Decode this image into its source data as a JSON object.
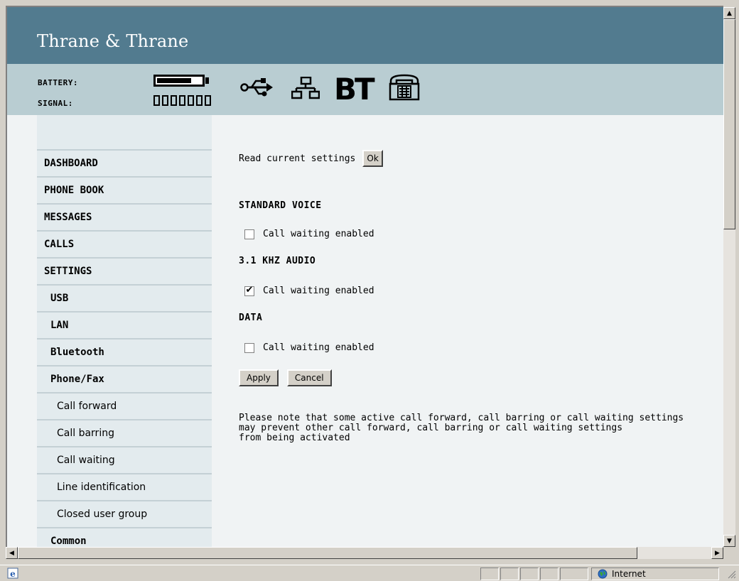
{
  "brand": {
    "name": "Thrane & Thrane"
  },
  "status": {
    "battery_label": "BATTERY:",
    "signal_label": "SIGNAL:",
    "battery_level": 0.72,
    "signal_bars_total": 7,
    "signal_bars_on": 0,
    "bt_label": "BT",
    "interface_icons": [
      "usb-icon",
      "lan-icon",
      "bluetooth-icon",
      "phone-icon"
    ]
  },
  "nav": {
    "items": [
      {
        "label": "DASHBOARD",
        "level": 0
      },
      {
        "label": "PHONE BOOK",
        "level": 0
      },
      {
        "label": "MESSAGES",
        "level": 0
      },
      {
        "label": "CALLS",
        "level": 0
      },
      {
        "label": "SETTINGS",
        "level": 0
      },
      {
        "label": "USB",
        "level": 1
      },
      {
        "label": "LAN",
        "level": 1
      },
      {
        "label": "Bluetooth",
        "level": 1
      },
      {
        "label": "Phone/Fax",
        "level": 1
      },
      {
        "label": "Call forward",
        "level": 2
      },
      {
        "label": "Call barring",
        "level": 2
      },
      {
        "label": "Call waiting",
        "level": 2
      },
      {
        "label": "Line identification",
        "level": 2
      },
      {
        "label": "Closed user group",
        "level": 2
      },
      {
        "label": "Common",
        "level": 1
      }
    ]
  },
  "main": {
    "read_settings_label": "Read current settings",
    "ok_label": "Ok",
    "sections": [
      {
        "heading": "STANDARD VOICE",
        "option_label": "Call waiting enabled",
        "checked": false
      },
      {
        "heading": "3.1 KHZ AUDIO",
        "option_label": "Call waiting enabled",
        "checked": true
      },
      {
        "heading": "DATA",
        "option_label": "Call waiting enabled",
        "checked": false
      }
    ],
    "apply_label": "Apply",
    "cancel_label": "Cancel",
    "note": "Please note that some active call forward, call barring or call waiting settings\nmay prevent other call forward, call barring or call waiting settings\nfrom being activated"
  },
  "browser": {
    "zone_label": "Internet"
  },
  "colors": {
    "brand_bar": "#527b8f",
    "status_bar": "#b9cdd2",
    "sidebar": "#e3ebee",
    "content_bg": "#f0f3f4"
  }
}
